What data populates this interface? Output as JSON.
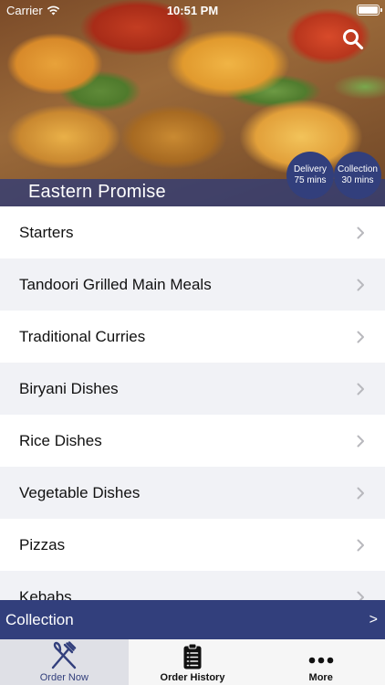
{
  "status_bar": {
    "carrier": "Carrier",
    "time": "10:51 PM",
    "icons": [
      "wifi-icon",
      "battery-icon"
    ]
  },
  "hero": {
    "restaurant_name": "Eastern Promise",
    "search_icon": "search-icon",
    "delivery": {
      "label": "Delivery",
      "time": "75 mins"
    },
    "collection": {
      "label": "Collection",
      "time": "30 mins"
    }
  },
  "menu": {
    "items": [
      {
        "label": "Starters"
      },
      {
        "label": "Tandoori Grilled Main Meals"
      },
      {
        "label": "Traditional Curries"
      },
      {
        "label": "Biryani Dishes"
      },
      {
        "label": "Rice Dishes"
      },
      {
        "label": "Vegetable Dishes"
      },
      {
        "label": "Pizzas"
      },
      {
        "label": "Kebabs"
      }
    ]
  },
  "order_type_bar": {
    "label": "Collection",
    "arrow": ">"
  },
  "tab_bar": {
    "tabs": [
      {
        "label": "Order Now",
        "icon": "cutlery-icon",
        "active": true
      },
      {
        "label": "Order History",
        "icon": "clipboard-icon",
        "active": false
      },
      {
        "label": "More",
        "icon": "more-dots-icon",
        "active": false
      }
    ]
  },
  "colors": {
    "brand": "#323f7c",
    "row_alt": "#f1f2f6"
  }
}
